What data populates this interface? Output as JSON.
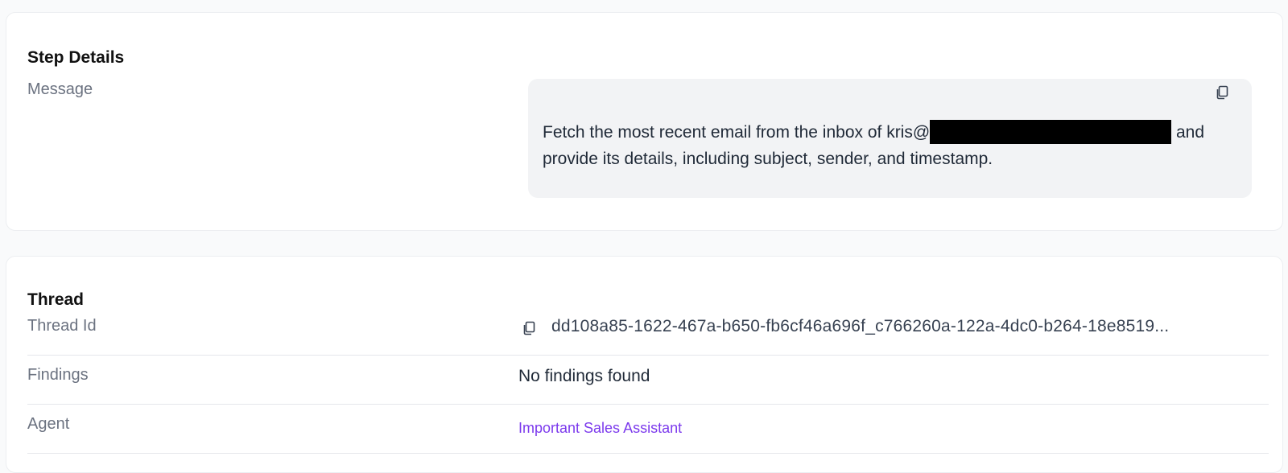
{
  "step_details": {
    "title": "Step Details",
    "message_label": "Message",
    "message_text_before": "Fetch the most recent email from the inbox of kris@",
    "message_text_after": " and provide its details, including subject, sender, and timestamp.",
    "copy_icon": "copy-icon"
  },
  "thread": {
    "title": "Thread",
    "thread_id_label": "Thread Id",
    "thread_id_value": "dd108a85-1622-467a-b650-fb6cf46a696f_c766260a-122a-4dc0-b264-18e8519...",
    "findings_label": "Findings",
    "findings_value": "No findings found",
    "agent_label": "Agent",
    "agent_value": "Important Sales Assistant",
    "copy_icon": "copy-icon"
  },
  "colors": {
    "accent_link": "#7c3aed",
    "message_bg": "#f2f3f5",
    "label_gray": "#6b7280"
  }
}
